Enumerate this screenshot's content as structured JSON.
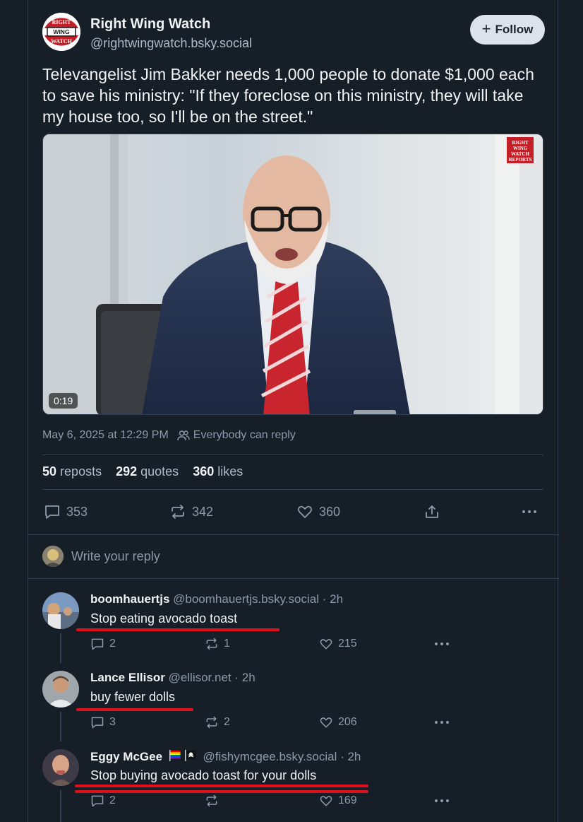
{
  "post": {
    "author_name": "Right Wing Watch",
    "author_handle": "@rightwingwatch.bsky.social",
    "avatar_lines": [
      "RIGHT",
      "WING",
      "WATCH"
    ],
    "follow_label": "Follow",
    "text": "Televangelist Jim Bakker needs 1,000 people to donate $1,000 each to save his ministry: \"If they foreclose on this ministry, they will take my house too, so I'll be on the street.\"",
    "video_duration": "0:19",
    "watermark_lines": [
      "RIGHT",
      "WING",
      "WATCH",
      "REPORTS"
    ],
    "timestamp": "May 6, 2025 at 12:29 PM",
    "reply_permission": "Everybody can reply",
    "stats": {
      "reposts_count": "50",
      "reposts_label": "reposts",
      "quotes_count": "292",
      "quotes_label": "quotes",
      "likes_count": "360",
      "likes_label": "likes"
    },
    "actions": {
      "replies": "353",
      "reposts": "342",
      "likes": "360"
    }
  },
  "compose": {
    "placeholder": "Write your reply"
  },
  "replies": [
    {
      "name": "boomhauertjs",
      "handle": "@boomhauertjs.bsky.social",
      "time": "· 2h",
      "text": "Stop eating avocado toast",
      "replies": "2",
      "reposts": "1",
      "likes": "215"
    },
    {
      "name": "Lance Ellisor",
      "handle": "@ellisor.net",
      "time": "· 2h",
      "text": "buy fewer dolls",
      "replies": "3",
      "reposts": "2",
      "likes": "206"
    },
    {
      "name": "Eggy McGee",
      "handle": "@fishymcgee.bsky.social",
      "time": "· 2h",
      "text": "Stop buying avocado toast for your dolls",
      "replies": "2",
      "reposts": "",
      "likes": "169"
    }
  ],
  "colors": {
    "background": "#161e27",
    "border": "#2e4052",
    "muted_text": "#8c9aab",
    "follow_button": "#dce2ea",
    "annotation_underline": "#e0101a"
  },
  "icons": [
    "plus-icon",
    "people-icon",
    "reply-icon",
    "repost-icon",
    "heart-icon",
    "share-icon",
    "more-icon",
    "rainbow-flag-icon",
    "pirate-flag-icon"
  ]
}
